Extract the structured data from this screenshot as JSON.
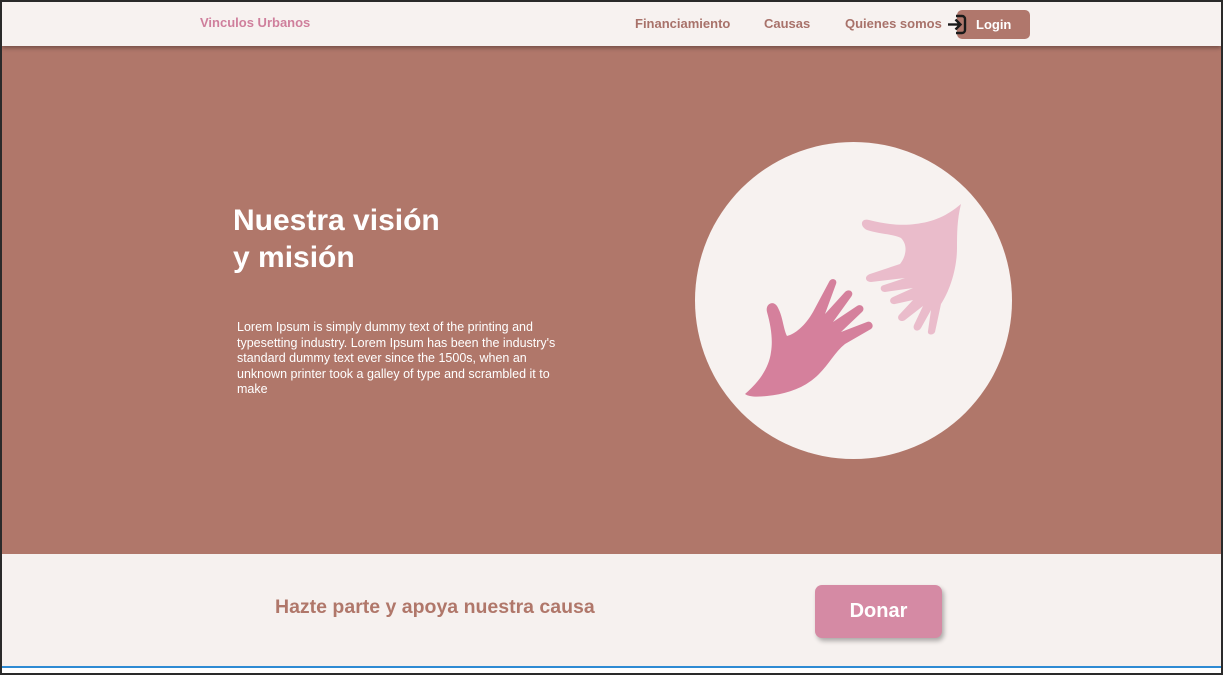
{
  "header": {
    "brand": "Vinculos Urbanos",
    "nav": [
      "Financiamiento",
      "Causas",
      "Quienes somos"
    ],
    "login_label": "Login",
    "login_icon": "login-arrow-icon"
  },
  "hero": {
    "title_line1": "Nuestra visión",
    "title_line2": "y misión",
    "text": "Lorem Ipsum is simply dummy text of the printing and  typesetting industry. Lorem Ipsum has been the industry's standard dummy text ever since the 1500s, when an unknown printer took a galley of type and scrambled it to make",
    "image_icon": "helping-hands-icon"
  },
  "cta": {
    "text": "Hazte parte y apoya nuestra causa",
    "donate_label": "Donar"
  },
  "colors": {
    "brand_pink": "#cf7f9c",
    "hero_bg": "#b0776a",
    "light_bg": "#f6f1ef",
    "donate_bg": "#d58aa4",
    "hand_dark": "#d5809c",
    "hand_light": "#eabccb"
  }
}
